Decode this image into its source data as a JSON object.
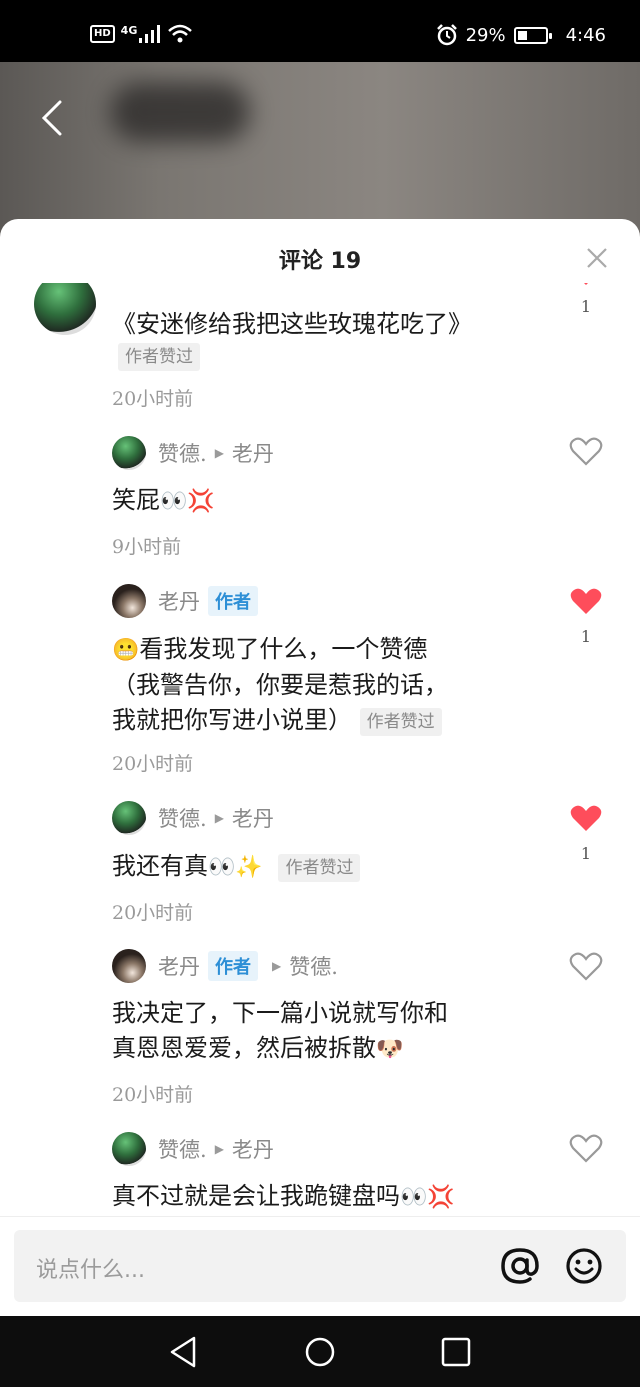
{
  "status_bar": {
    "hd": "HD",
    "signal": "4G",
    "battery_percent": "29%",
    "time": "4:46"
  },
  "sheet": {
    "title": "评论 19"
  },
  "comments": [
    {
      "text": "《安迷修给我把这些玫瑰花吃了》",
      "liked_tag": "作者赞过",
      "time": "20小时前",
      "like_count": "1"
    },
    {
      "name": "赞德.",
      "reply_to": "老丹",
      "text": "笑屁",
      "time": "9小时前"
    },
    {
      "name": "老丹",
      "author_tag": "作者",
      "text": "看我发现了什么，一个赞德（我警告你，你要是惹我的话，我就把你写进小说里）",
      "text_line1": "看我发现了什么，一个赞德",
      "text_line2": "（我警告你，你要是惹我的话，",
      "text_line3": "我就把你写进小说里）",
      "liked_tag": "作者赞过",
      "time": "20小时前",
      "like_count": "1"
    },
    {
      "name": "赞德.",
      "reply_to": "老丹",
      "text": "我还有真",
      "liked_tag": "作者赞过",
      "time": "20小时前",
      "like_count": "1"
    },
    {
      "name": "老丹",
      "author_tag": "作者",
      "reply_to": "赞德.",
      "text_line1": "我决定了，下一篇小说就写你和",
      "text_line2": "真恩恩爱爱，然后被拆散",
      "time": "20小时前"
    },
    {
      "name": "赞德.",
      "reply_to": "老丹",
      "text": "真不过就是会让我跪键盘吗"
    }
  ],
  "input": {
    "placeholder": "说点什么..."
  },
  "colors": {
    "heart_active": "#fe4d5b",
    "author_tag": "#2d8fd6"
  }
}
